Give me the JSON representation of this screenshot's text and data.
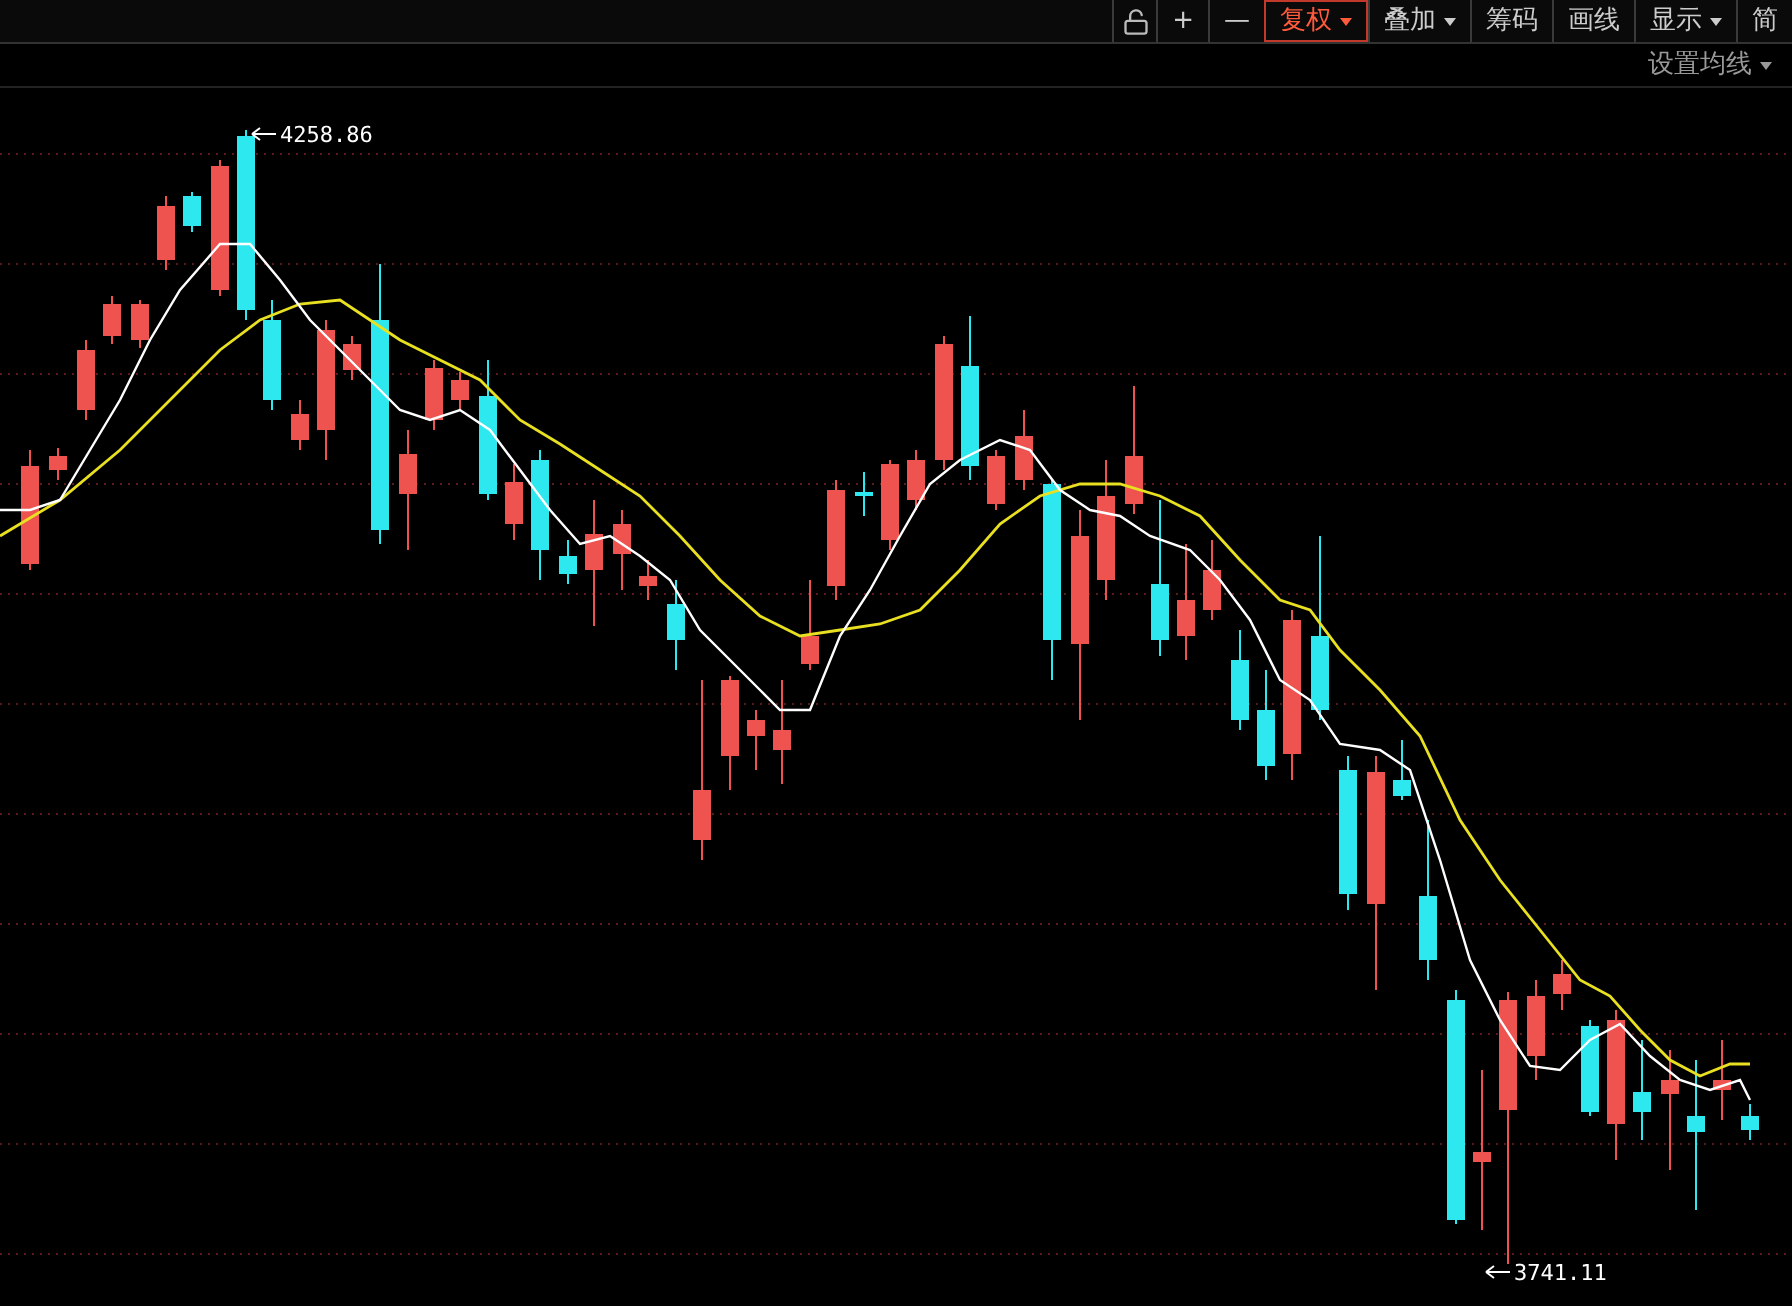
{
  "toolbar": [
    {
      "kind": "lock"
    },
    {
      "kind": "text",
      "label": "+",
      "selected": false,
      "has_menu": false
    },
    {
      "kind": "text",
      "label": "—",
      "selected": false,
      "has_menu": false
    },
    {
      "kind": "text",
      "label": "复权",
      "selected": true,
      "has_menu": true
    },
    {
      "kind": "text",
      "label": "叠加",
      "selected": false,
      "has_menu": true
    },
    {
      "kind": "text",
      "label": "筹码",
      "selected": false,
      "has_menu": false
    },
    {
      "kind": "text",
      "label": "画线",
      "selected": false,
      "has_menu": false
    },
    {
      "kind": "text",
      "label": "显示",
      "selected": false,
      "has_menu": true
    },
    {
      "kind": "text",
      "label": "简",
      "selected": false,
      "has_menu": false
    }
  ],
  "ma_settings": {
    "label": "设置均线"
  },
  "chart": {
    "high_label": "4258.86",
    "low_label": "3741.11"
  }
}
